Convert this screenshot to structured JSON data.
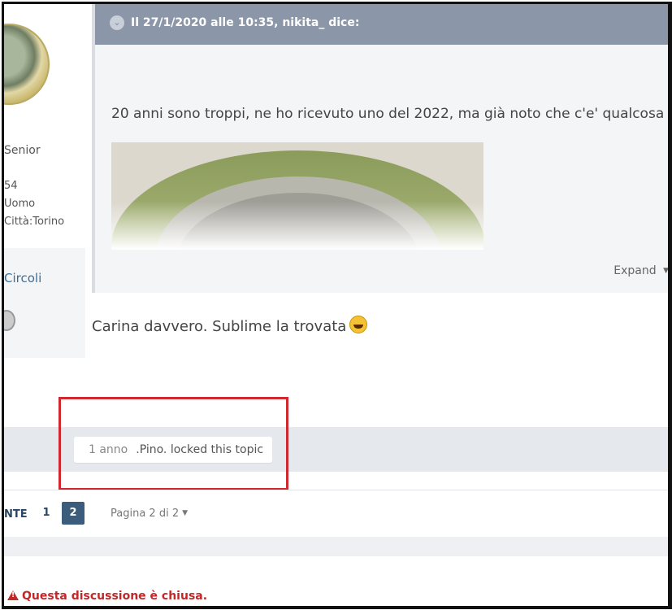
{
  "author": {
    "rank": "Senior",
    "meta": [
      "54",
      "Uomo",
      "Città:Torino"
    ],
    "badge_label": "Circoli"
  },
  "quote": {
    "header": "Il 27/1/2020 alle 10:35, nikita_ dice:",
    "body": "20 anni sono troppi, ne ho ricevuto uno del 2022, ma già noto che c'e' qualcosa",
    "expand_label": "Expand"
  },
  "reply": {
    "text": "Carina davvero. Sublime la trovata",
    "emoji": "laughing-emoji"
  },
  "event": {
    "time": "1 anno",
    "text": ".Pino. locked this topic"
  },
  "pagination": {
    "prev_label": "NTE",
    "pages": [
      "1",
      "2"
    ],
    "current_page": "2",
    "jump_label": "Pagina 2 di 2"
  },
  "notice": {
    "text": "Questa discussione è chiusa."
  },
  "colors": {
    "quote_header": "#8b96a8",
    "pagination_active": "#3b5c7a",
    "highlight_box": "#d0282f",
    "notice": "#c22828"
  }
}
